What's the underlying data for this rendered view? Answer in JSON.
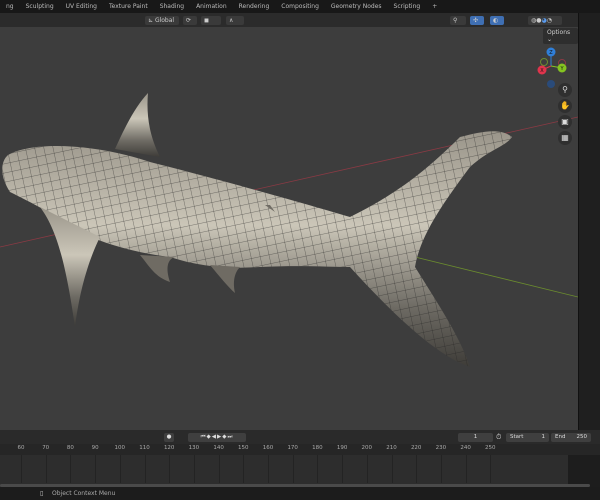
{
  "workspace_tabs": [
    "ng",
    "Sculpting",
    "UV Editing",
    "Texture Paint",
    "Shading",
    "Animation",
    "Rendering",
    "Compositing",
    "Geometry Nodes",
    "Scripting",
    "+"
  ],
  "header": {
    "transform_orientation": "Global",
    "options_label": "Options"
  },
  "gizmo": {
    "x": "X",
    "y": "Y",
    "z": "Z"
  },
  "nav_icons": [
    "zoom-icon",
    "hand-pan-icon",
    "camera-icon",
    "grid-ortho-icon"
  ],
  "timeline": {
    "current_frame": "1",
    "start_label": "Start",
    "start": "1",
    "end_label": "End",
    "end": "250",
    "ruler": [
      "60",
      "70",
      "80",
      "90",
      "100",
      "110",
      "120",
      "130",
      "140",
      "150",
      "160",
      "170",
      "180",
      "190",
      "200",
      "210",
      "220",
      "230",
      "240",
      "250"
    ]
  },
  "status": {
    "hint": "Object Context Menu"
  },
  "colors": {
    "x_axis": "#e0344c",
    "y_axis": "#84c421",
    "z_axis": "#2f7fd8"
  }
}
